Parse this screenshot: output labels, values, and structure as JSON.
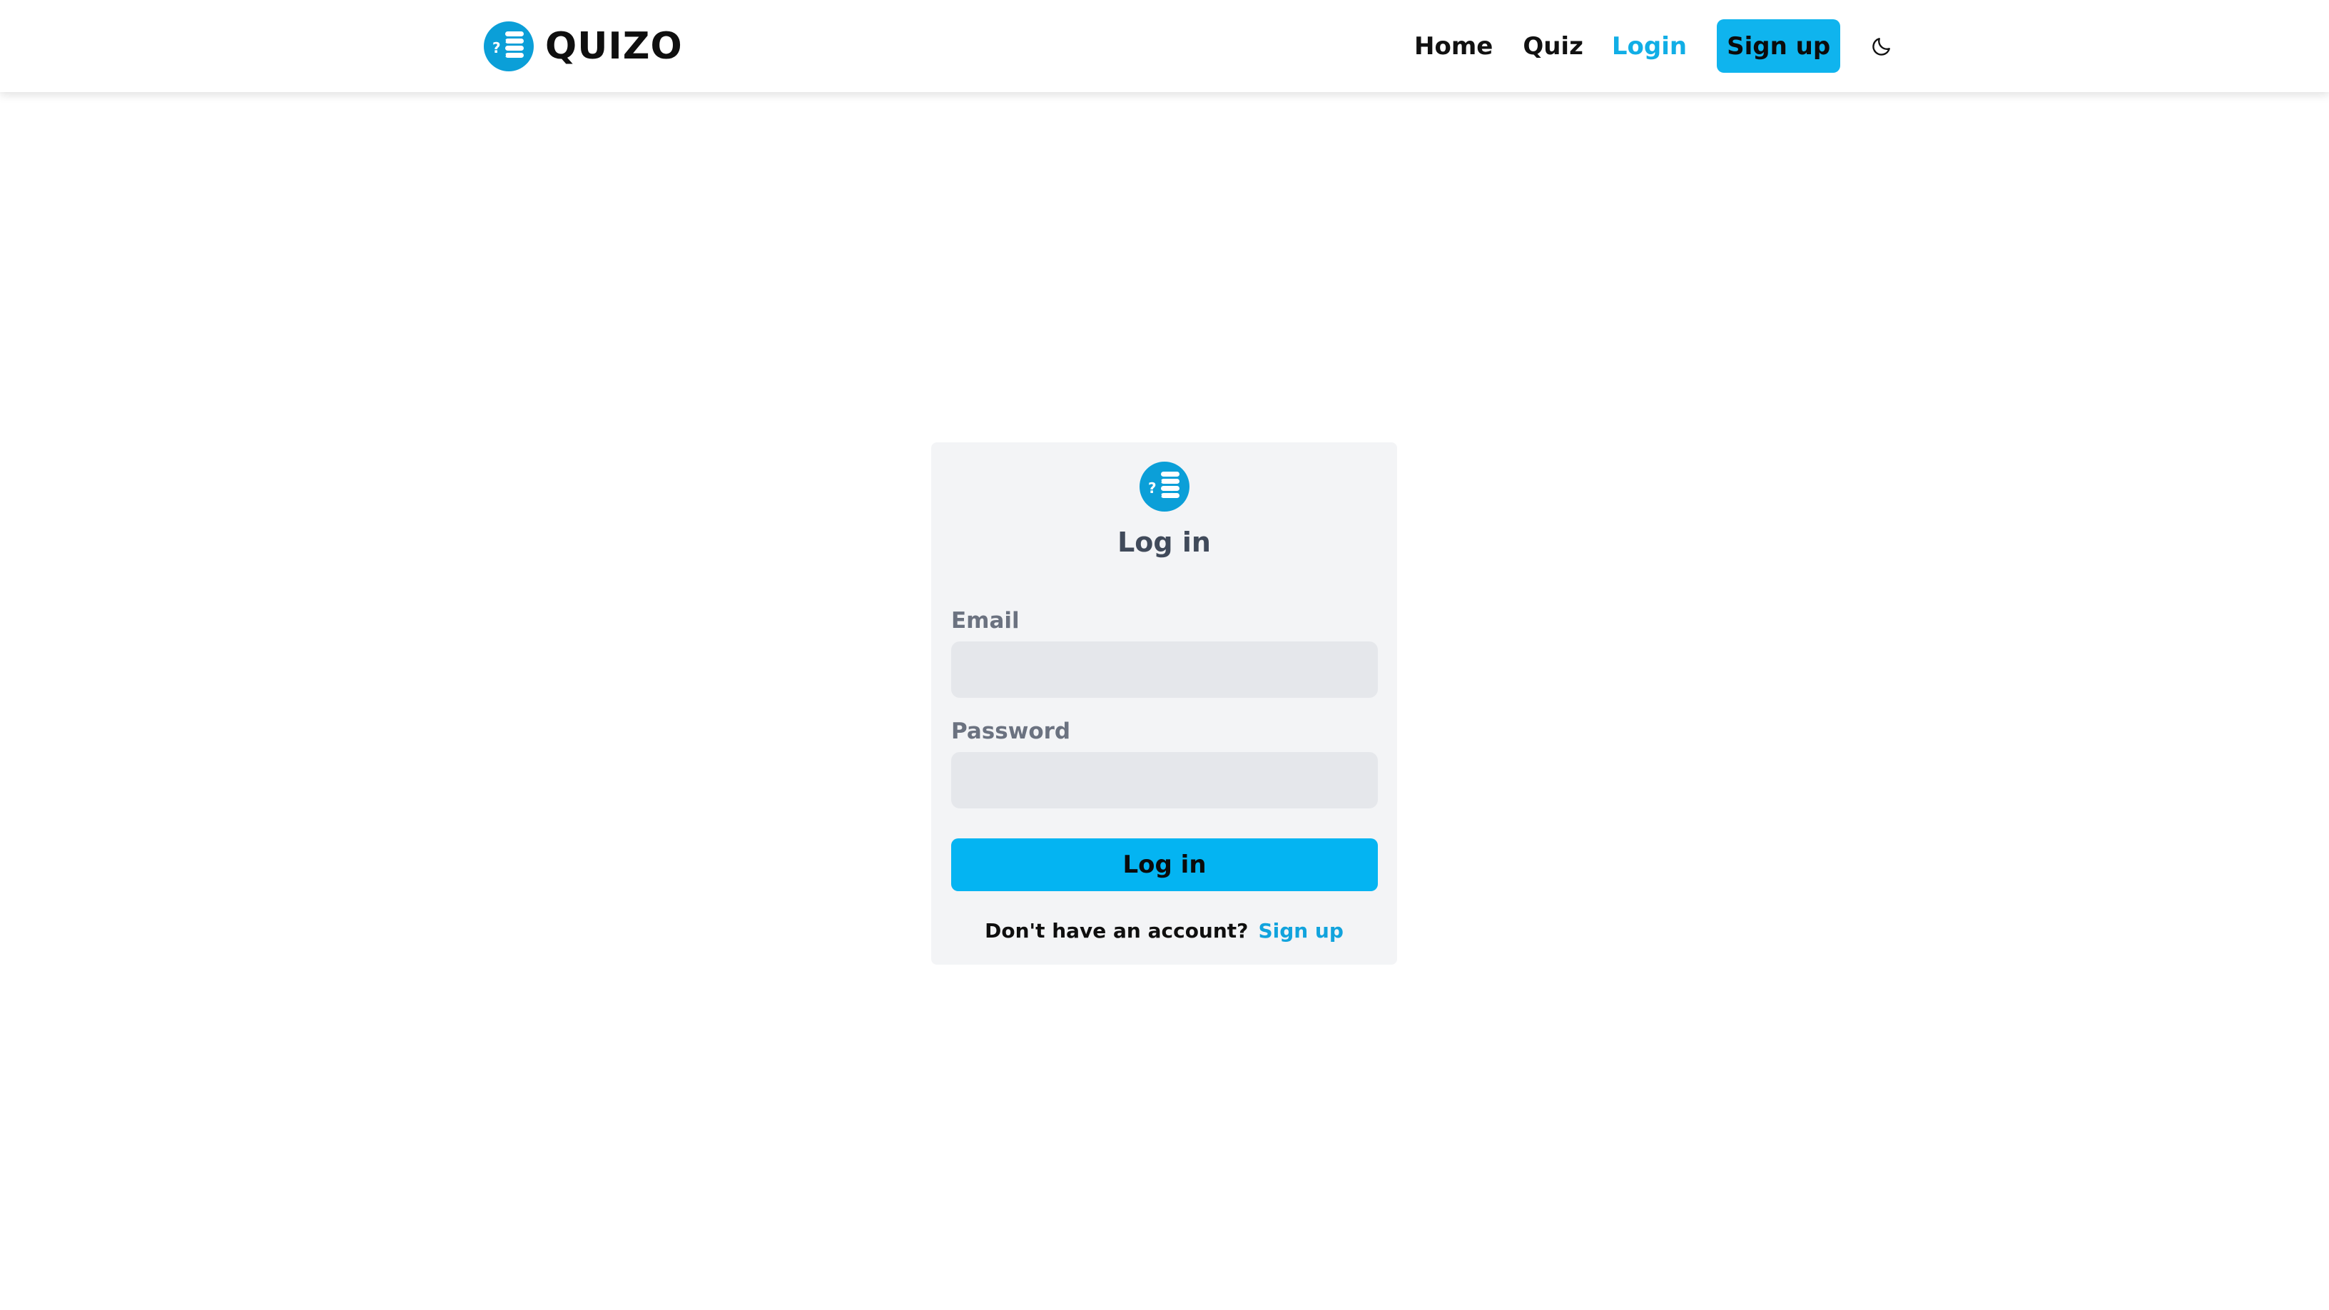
{
  "brand": {
    "name": "QUIZO",
    "icon": "quiz-list-logo-icon"
  },
  "nav": {
    "home": "Home",
    "quiz": "Quiz",
    "login": "Login",
    "signup": "Sign up",
    "theme_icon": "moon-icon"
  },
  "login_form": {
    "title": "Log in",
    "email_label": "Email",
    "email_value": "",
    "password_label": "Password",
    "password_value": "",
    "submit_label": "Log in",
    "no_account_text": "Don't have an account?",
    "signup_link": "Sign up"
  },
  "colors": {
    "accent": "#0fb4ee",
    "card_bg": "#f3f4f6",
    "input_bg": "#e5e7eb",
    "label": "#6b7280",
    "title": "#404a5a"
  }
}
